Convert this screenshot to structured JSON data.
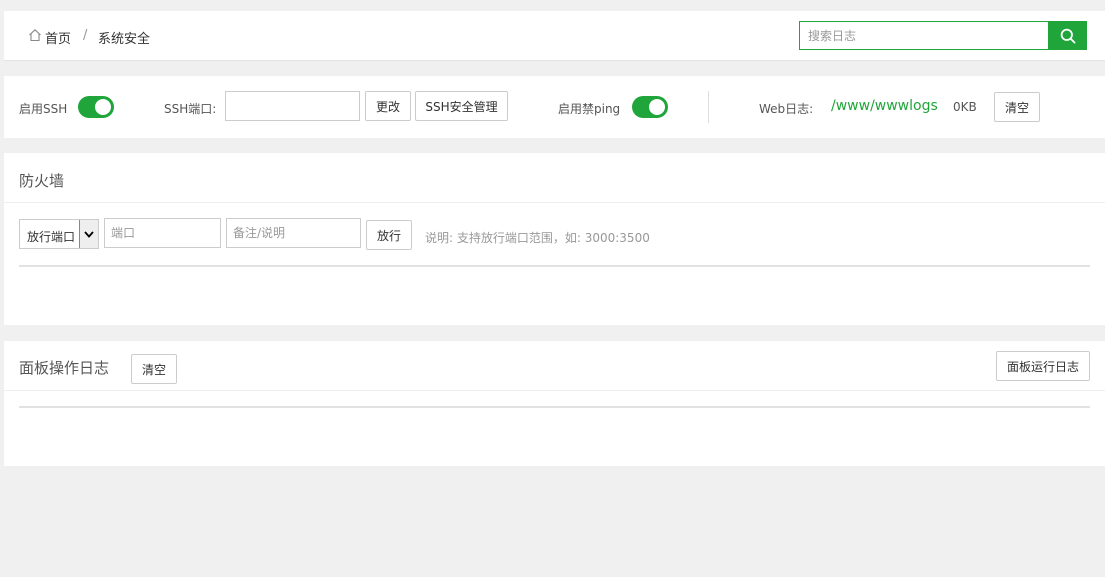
{
  "breadcrumb": {
    "home": "首页",
    "separator": "/",
    "current": "系统安全"
  },
  "search": {
    "placeholder": "搜索日志",
    "icon": "search-icon"
  },
  "ssh": {
    "enable_label": "启用SSH",
    "enable_on": true,
    "port_label": "SSH端口:",
    "port_value": "",
    "change_button": "更改",
    "manage_button": "SSH安全管理",
    "ping_label": "启用禁ping",
    "ping_on": true,
    "weblog_label": "Web日志:",
    "weblog_path": "/www/wwwlogs",
    "weblog_size": "0KB",
    "clear_button": "清空"
  },
  "firewall": {
    "title": "防火墙",
    "type_select": "放行端口",
    "port_placeholder": "端口",
    "note_placeholder": "备注/说明",
    "submit_button": "放行",
    "hint": "说明: 支持放行端口范围，如: 3000:3500"
  },
  "panel_log": {
    "title": "面板操作日志",
    "clear_button": "清空",
    "run_log_button": "面板运行日志"
  },
  "colors": {
    "accent": "#20a53a",
    "background": "#f0f0f0"
  }
}
